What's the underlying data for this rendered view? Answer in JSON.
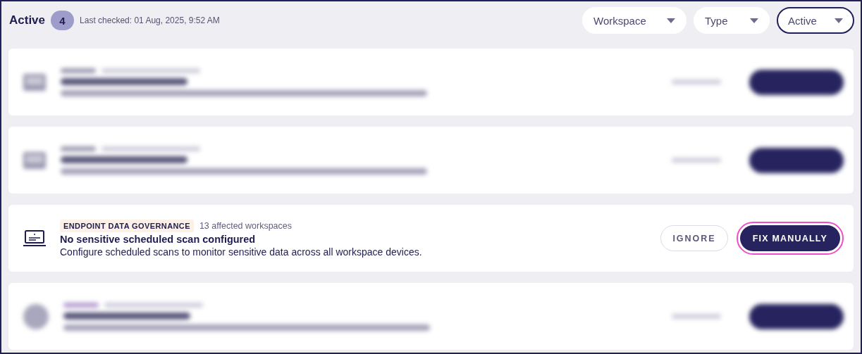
{
  "header": {
    "title": "Active",
    "count": "4",
    "last_checked": "Last checked: 01 Aug, 2025, 9:52 AM"
  },
  "filters": [
    {
      "label": "Workspace",
      "selected": false
    },
    {
      "label": "Type",
      "selected": false
    },
    {
      "label": "Active",
      "selected": true
    }
  ],
  "issues": [
    {
      "kind": "blurred"
    },
    {
      "kind": "blurred"
    },
    {
      "kind": "clear",
      "category": "ENDPOINT DATA GOVERNANCE",
      "affected": "13 affected workspaces",
      "title": "No sensitive scheduled scan configured",
      "description": "Configure scheduled scans to monitor sensitive data across all workspace devices.",
      "ignore": "IGNORE",
      "action": {
        "label": "FIX MANUALLY",
        "highlighted": true
      }
    },
    {
      "kind": "blurredround"
    }
  ]
}
